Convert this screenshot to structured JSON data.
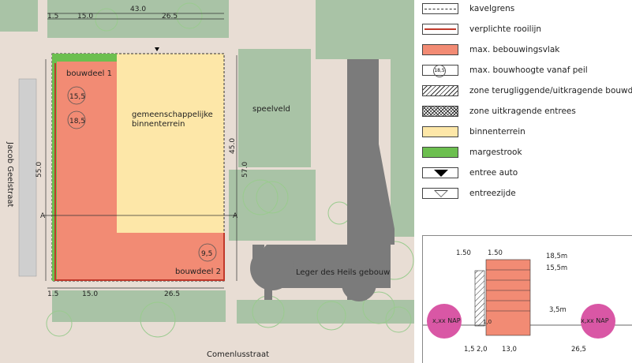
{
  "colors": {
    "bebouwingsvlak": "#f28b74",
    "binnenterrein": "#fde7a8",
    "margestrook": "#6cbf4f",
    "road": "#e8dcd3",
    "green": "#a9c3a6",
    "building": "#7b7b7b",
    "nap_circle": "#d957a5",
    "rooilijn": "#c0392b"
  },
  "map": {
    "street_west": "Jacob Geelstraat",
    "street_south": "Comenlusstraat",
    "bouwdeel1": "bouwdeel 1",
    "bouwdeel2": "bouwdeel 2",
    "binnenterrein": "gemeenschappelijke\nbinnenterrein",
    "speelveld": "speelveld",
    "leger": "Leger des Heils gebouw",
    "heights": [
      "15,5",
      "18,5",
      "9,5"
    ],
    "section_marker": "A",
    "dims_top": [
      "43.0",
      "1.5",
      "15.0",
      "26.5"
    ],
    "dims_bottom": [
      "1.5",
      "15.0",
      "26.5"
    ],
    "dims_left": [
      "55.0"
    ],
    "dims_right": [
      "45.0",
      "57.0"
    ]
  },
  "legend": {
    "items": [
      {
        "label": "kavelgrens",
        "icon": "kavelgrens-line"
      },
      {
        "label": "verplichte rooilijn",
        "icon": "rooilijn-line"
      },
      {
        "label": "max. bebouwingsvlak",
        "icon": "bebouwingsvlak-fill"
      },
      {
        "label": "max. bouwhoogte vanaf peil",
        "icon": "height-circle",
        "sample": "18,5"
      },
      {
        "label": "zone terugliggende/uitkragende bouwdelen",
        "icon": "hatch"
      },
      {
        "label": "zone uitkragende entrees",
        "icon": "crosshatch"
      },
      {
        "label": "binnenterrein",
        "icon": "binnenterrein-fill"
      },
      {
        "label": "margestrook",
        "icon": "margestrook-fill"
      },
      {
        "label": "entree auto",
        "icon": "filled-triangle"
      },
      {
        "label": "entreezijde",
        "icon": "outline-triangle"
      }
    ]
  },
  "section": {
    "top_dims": [
      "1.50",
      "1.50"
    ],
    "heights": [
      "18,5m",
      "15,5m",
      "3,5m"
    ],
    "floor": "1,0",
    "nap": "x,xx NAP",
    "bottom_dims": [
      "1,5",
      "2,0",
      "13,0",
      "26,5"
    ]
  }
}
